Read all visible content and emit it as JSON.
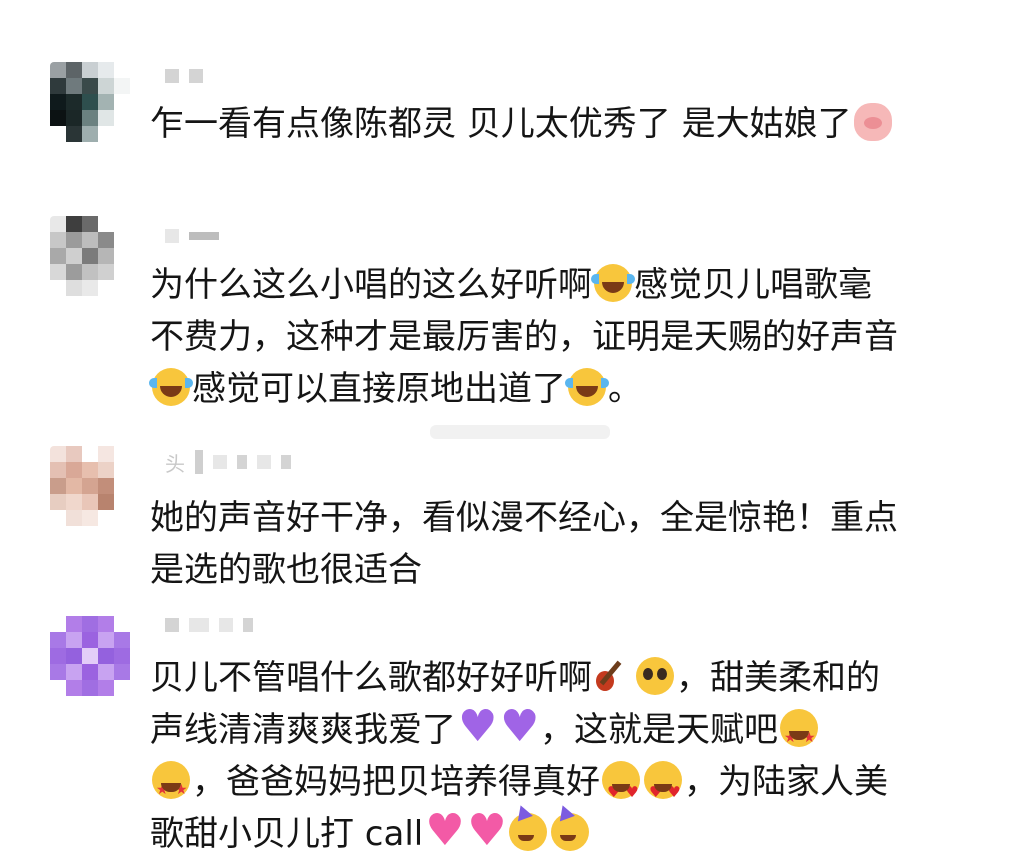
{
  "comments": [
    {
      "avatar": "avatar-1",
      "text": "乍一看有点像陈都灵 贝儿太优秀了 是大姑娘了",
      "emoji_end": "pig-nose-emoji"
    },
    {
      "avatar": "avatar-2",
      "line1_a": "为什么这么小唱的这么好听啊",
      "line1_b": "感觉贝儿唱歌毫",
      "line2": "不费力，这种才是最厉害的，证明是天赐的好声音",
      "line3_a": "感觉可以直接原地出道了",
      "line3_b": "。",
      "emoji": "laugh-cry-emoji"
    },
    {
      "avatar": "avatar-3",
      "nick": "头",
      "line1": "她的声音好干净，看似漫不经心，全是惊艳！重点",
      "line2": "是选的歌也很适合"
    },
    {
      "avatar": "avatar-4",
      "line1_a": "贝儿不管唱什么歌都好好听啊",
      "line1_b": "，甜美柔和的",
      "line2_a": "声线清清爽爽我爱了",
      "line2_b": "，这就是天赋吧",
      "line3_a": "，爸爸妈妈把贝培养得真好",
      "line3_b": "，为陆家人美",
      "line4": "歌甜小贝儿打 call"
    }
  ],
  "icons": {
    "pig": "pig-nose-emoji",
    "laugh_cry": "face-with-tears-of-joy-emoji",
    "guitar": "guitar-emoji",
    "pleading": "pleading-face-emoji",
    "purple_heart": "purple-heart-emoji",
    "star_eyes": "star-struck-emoji",
    "heart_eyes": "heart-eyes-emoji",
    "sparkle_heart": "sparkling-heart-emoji",
    "party": "partying-face-emoji"
  },
  "colors": {
    "text": "#151515",
    "background": "#ffffff",
    "blur": "#d4d4d4"
  }
}
